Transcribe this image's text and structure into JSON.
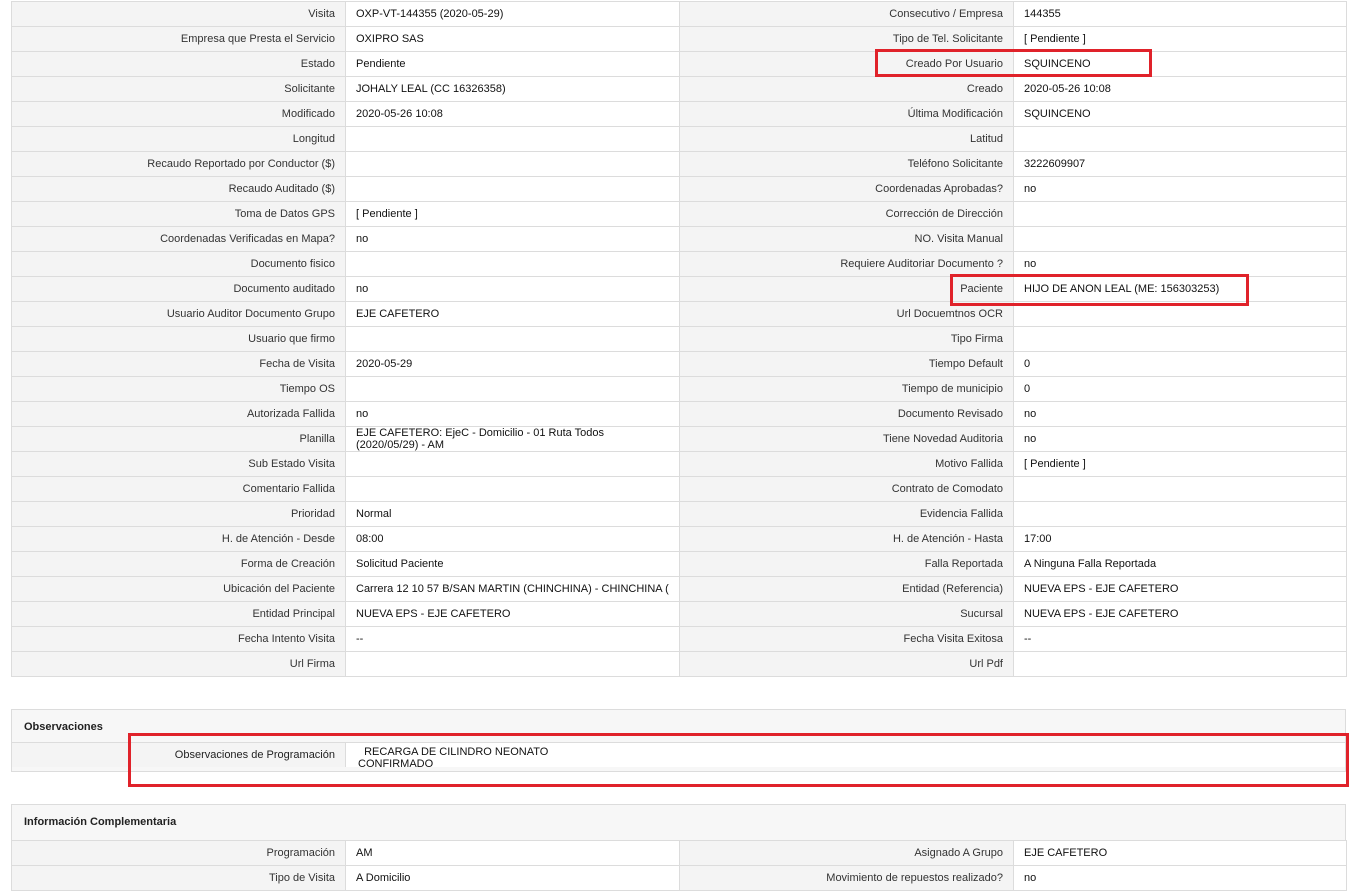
{
  "main_rows": [
    [
      "Visita",
      "OXP-VT-144355 (2020-05-29)",
      "Consecutivo / Empresa",
      "144355"
    ],
    [
      "Empresa que Presta el Servicio",
      "OXIPRO SAS",
      "Tipo de Tel. Solicitante",
      "[ Pendiente ]"
    ],
    [
      "Estado",
      "Pendiente",
      "Creado Por Usuario",
      "SQUINCENO"
    ],
    [
      "Solicitante",
      "JOHALY LEAL (CC 16326358)",
      "Creado",
      "2020-05-26 10:08"
    ],
    [
      "Modificado",
      "2020-05-26 10:08",
      "Última Modificación",
      " SQUINCENO"
    ],
    [
      "Longitud",
      "",
      "Latitud",
      ""
    ],
    [
      "Recaudo Reportado por Conductor ($)",
      "",
      "Teléfono Solicitante",
      "3222609907"
    ],
    [
      "Recaudo Auditado ($)",
      "",
      "Coordenadas Aprobadas?",
      " no"
    ],
    [
      "Toma de Datos GPS",
      "[ Pendiente ]",
      "Corrección de Dirección",
      ""
    ],
    [
      "Coordenadas Verificadas en Mapa?",
      " no",
      "NO. Visita Manual",
      ""
    ],
    [
      "Documento fisico",
      "",
      "Requiere Auditoriar Documento ?",
      " no"
    ],
    [
      "Documento auditado",
      " no",
      "Paciente",
      "HIJO DE ANON LEAL (ME: 156303253)"
    ],
    [
      "Usuario Auditor Documento Grupo",
      "EJE CAFETERO",
      "Url Docuemtnos OCR",
      ""
    ],
    [
      "Usuario que firmo",
      "",
      "Tipo Firma",
      ""
    ],
    [
      "Fecha de Visita",
      " 2020-05-29",
      "Tiempo Default",
      "0"
    ],
    [
      "Tiempo OS",
      "",
      "Tiempo de municipio",
      "0"
    ],
    [
      "Autorizada Fallida",
      " no",
      "Documento Revisado",
      " no"
    ],
    [
      "Planilla",
      "EJE CAFETERO: EjeC - Domicilio - 01 Ruta Todos (2020/05/29) - AM",
      "Tiene Novedad Auditoria",
      " no"
    ],
    [
      "Sub Estado Visita",
      "",
      "Motivo Fallida",
      "[ Pendiente ]"
    ],
    [
      "Comentario Fallida",
      "",
      "Contrato de Comodato",
      ""
    ],
    [
      "Prioridad",
      "Normal",
      "Evidencia Fallida",
      ""
    ],
    [
      "H. de Atención - Desde",
      "08:00",
      "H. de Atención - Hasta",
      "17:00"
    ],
    [
      "Forma de Creación",
      "Solicitud Paciente",
      "Falla Reportada",
      "A Ninguna Falla Reportada"
    ],
    [
      "Ubicación del Paciente",
      "Carrera 12 10 57 B/SAN MARTIN (CHINCHINA) - CHINCHINA (",
      "Entidad (Referencia)",
      "NUEVA EPS - EJE CAFETERO"
    ],
    [
      "Entidad Principal",
      "NUEVA EPS - EJE CAFETERO",
      "Sucursal",
      "NUEVA EPS - EJE CAFETERO"
    ],
    [
      "Fecha Intento Visita",
      " --",
      "Fecha Visita Exitosa",
      " --"
    ],
    [
      "Url Firma",
      "",
      "Url Pdf",
      ""
    ]
  ],
  "observaciones": {
    "title": "Observaciones",
    "label": "Observaciones de Programación",
    "value": "  RECARGA DE CILINDRO NEONATO\nCONFIRMADO"
  },
  "info": {
    "title": "Información Complementaria",
    "rows": [
      [
        "Programación",
        "AM",
        "Asignado A Grupo",
        "EJE CAFETERO"
      ],
      [
        "Tipo de Visita",
        "A Domicilio",
        "Movimiento de repuestos realizado?",
        " no"
      ]
    ]
  },
  "highlight_color": "#e0222a"
}
